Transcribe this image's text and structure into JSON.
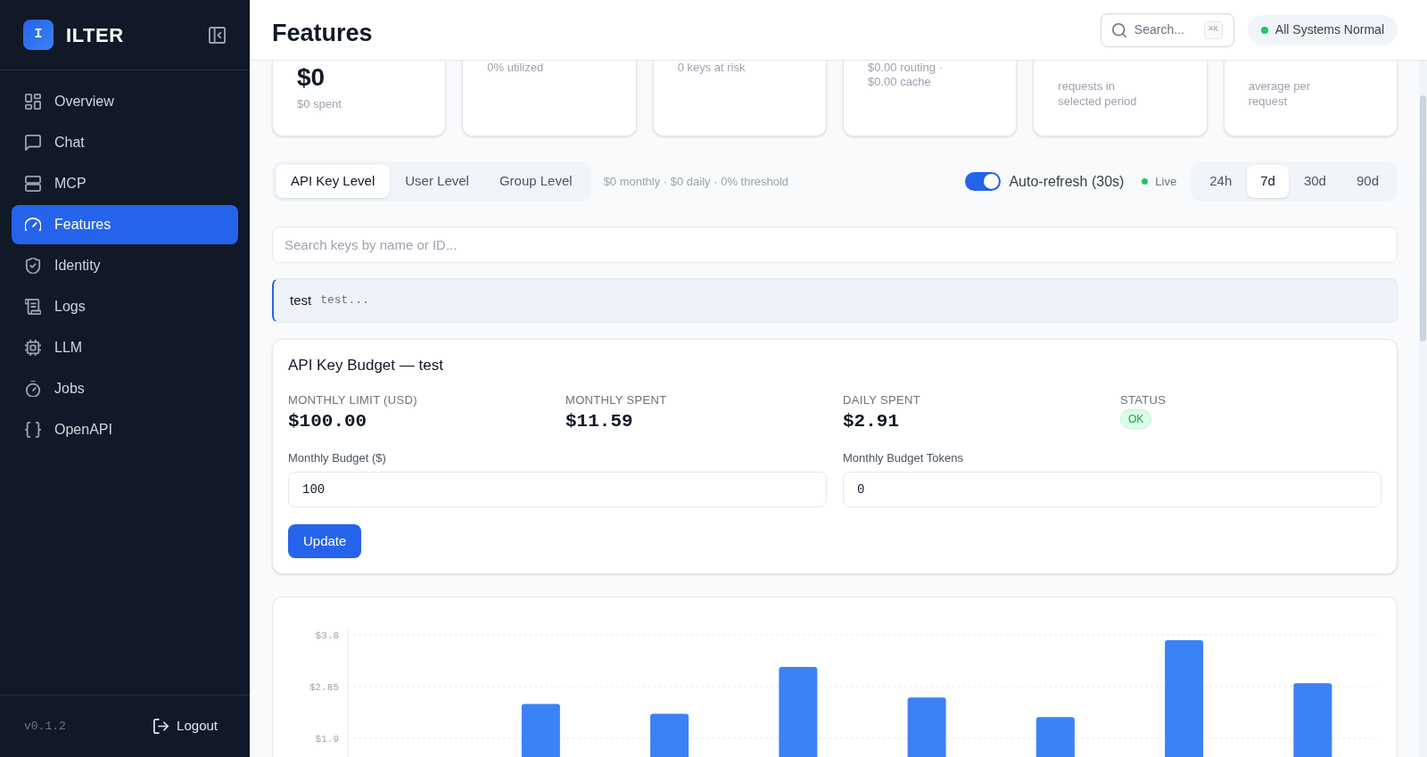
{
  "sidebar": {
    "brand": {
      "mark": "I",
      "name": "ILTER"
    },
    "items": [
      {
        "label": "Overview",
        "selected": false
      },
      {
        "label": "Chat",
        "selected": false
      },
      {
        "label": "MCP",
        "selected": false
      },
      {
        "label": "Features",
        "selected": true
      },
      {
        "label": "Identity",
        "selected": false
      },
      {
        "label": "Logs",
        "selected": false
      },
      {
        "label": "LLM",
        "selected": false
      },
      {
        "label": "Jobs",
        "selected": false
      },
      {
        "label": "OpenAPI",
        "selected": false
      }
    ],
    "version": "v0.1.2",
    "logout": "Logout"
  },
  "header": {
    "title": "Features",
    "search": {
      "placeholder": "Search...",
      "shortcut": "⌘K"
    },
    "status": "All Systems Normal"
  },
  "summary_cards": [
    {
      "kind": "value",
      "value": "$0",
      "note": "$0 spent"
    },
    {
      "kind": "note",
      "note": "0% utilized"
    },
    {
      "kind": "note",
      "note": "0 keys at risk"
    },
    {
      "kind": "note",
      "note": "$0.00 routing · $0.00 cache"
    },
    {
      "kind": "lower_note",
      "note": "requests in selected period"
    },
    {
      "kind": "lower_note",
      "note": "average per request"
    }
  ],
  "level_tabs": [
    {
      "label": "API Key Level",
      "selected": true
    },
    {
      "label": "User Level",
      "selected": false
    },
    {
      "label": "Group Level",
      "selected": false
    }
  ],
  "level_summary": "$0 monthly · $0 daily · 0% threshold",
  "auto_refresh": {
    "label": "Auto-refresh (30s)",
    "on": true
  },
  "live": "Live",
  "ranges": [
    {
      "label": "24h",
      "selected": false
    },
    {
      "label": "7d",
      "selected": true
    },
    {
      "label": "30d",
      "selected": false
    },
    {
      "label": "90d",
      "selected": false
    }
  ],
  "key_search": {
    "placeholder": "Search keys by name or ID..."
  },
  "keys": [
    {
      "name": "test",
      "id": "test...",
      "selected": true
    }
  ],
  "budget": {
    "title": "API Key Budget — test",
    "stats": [
      {
        "kind": "amount",
        "label": "MONTHLY LIMIT (USD)",
        "value": "$100.00"
      },
      {
        "kind": "amount",
        "label": "MONTHLY SPENT",
        "value": "$11.59"
      },
      {
        "kind": "amount",
        "label": "DAILY SPENT",
        "value": "$2.91"
      },
      {
        "kind": "badge",
        "label": "STATUS",
        "value": "OK"
      }
    ],
    "fields": [
      {
        "label": "Monthly Budget ($)",
        "value": "100"
      },
      {
        "label": "Monthly Budget Tokens",
        "value": "0"
      }
    ],
    "button": "Update"
  },
  "spend_chart": {
    "chart_data": {
      "type": "bar",
      "values": [
        null,
        2.53,
        2.35,
        3.21,
        2.65,
        2.29,
        3.7,
        2.91
      ],
      "ylim": [
        1.55,
        3.8
      ],
      "yticks": [
        {
          "value": 3.8,
          "label": "$3.8"
        },
        {
          "value": 2.85,
          "label": "$2.85"
        },
        {
          "value": 1.9,
          "label": "$1.9"
        }
      ]
    }
  }
}
